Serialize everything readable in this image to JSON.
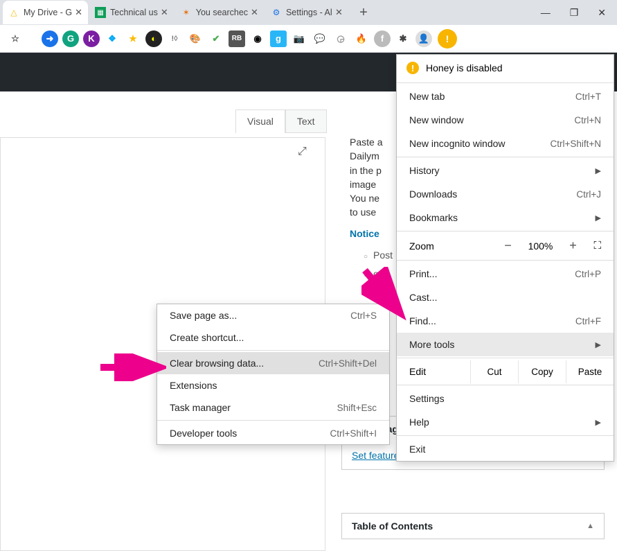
{
  "tabs": [
    {
      "title": "My Drive - G",
      "icon": "△"
    },
    {
      "title": "Technical us",
      "icon": "▦"
    },
    {
      "title": "You searchec",
      "icon": "✶"
    },
    {
      "title": "Settings - Al",
      "icon": "⚙"
    }
  ],
  "win": {
    "min": "—",
    "max": "❐",
    "close": "✕"
  },
  "toolbar": {
    "icons": [
      "☆",
      "●",
      "G",
      "K",
      "❖",
      "★",
      "◐",
      "!◊",
      "🎨",
      "V",
      "▣",
      "◉",
      "g",
      "📷",
      "💬",
      "◶",
      "🔥",
      "f",
      "✱"
    ],
    "avatar": "👤",
    "menu_glyph": "!"
  },
  "honey": {
    "text": "Honey is disabled"
  },
  "menu": {
    "new_tab": "New tab",
    "new_tab_sc": "Ctrl+T",
    "new_window": "New window",
    "new_window_sc": "Ctrl+N",
    "incognito": "New incognito window",
    "incognito_sc": "Ctrl+Shift+N",
    "history": "History",
    "downloads": "Downloads",
    "downloads_sc": "Ctrl+J",
    "bookmarks": "Bookmarks",
    "zoom": "Zoom",
    "zoom_val": "100%",
    "print": "Print...",
    "print_sc": "Ctrl+P",
    "cast": "Cast...",
    "find": "Find...",
    "find_sc": "Ctrl+F",
    "more_tools": "More tools",
    "edit": "Edit",
    "cut": "Cut",
    "copy": "Copy",
    "paste": "Paste",
    "settings": "Settings",
    "help": "Help",
    "exit": "Exit"
  },
  "submenu": {
    "save_page": "Save page as...",
    "save_page_sc": "Ctrl+S",
    "shortcut": "Create shortcut...",
    "clear": "Clear browsing data...",
    "clear_sc": "Ctrl+Shift+Del",
    "extensions": "Extensions",
    "task_mgr": "Task manager",
    "task_mgr_sc": "Shift+Esc",
    "dev_tools": "Developer tools",
    "dev_tools_sc": "Ctrl+Shift+I"
  },
  "editor": {
    "visual": "Visual",
    "text": "Text",
    "paste_hint": "Paste a",
    "line2": "Dailym",
    "line3": "in the p",
    "line4": "image",
    "line5": "You ne",
    "line6": "to use",
    "notice": "Notice",
    "b1": "Post",
    "b2": "ost",
    "b3": "Po"
  },
  "panels": {
    "featured_head": "…ed Image",
    "featured_link": "Set featured image",
    "toc_head": "Table of Contents"
  }
}
